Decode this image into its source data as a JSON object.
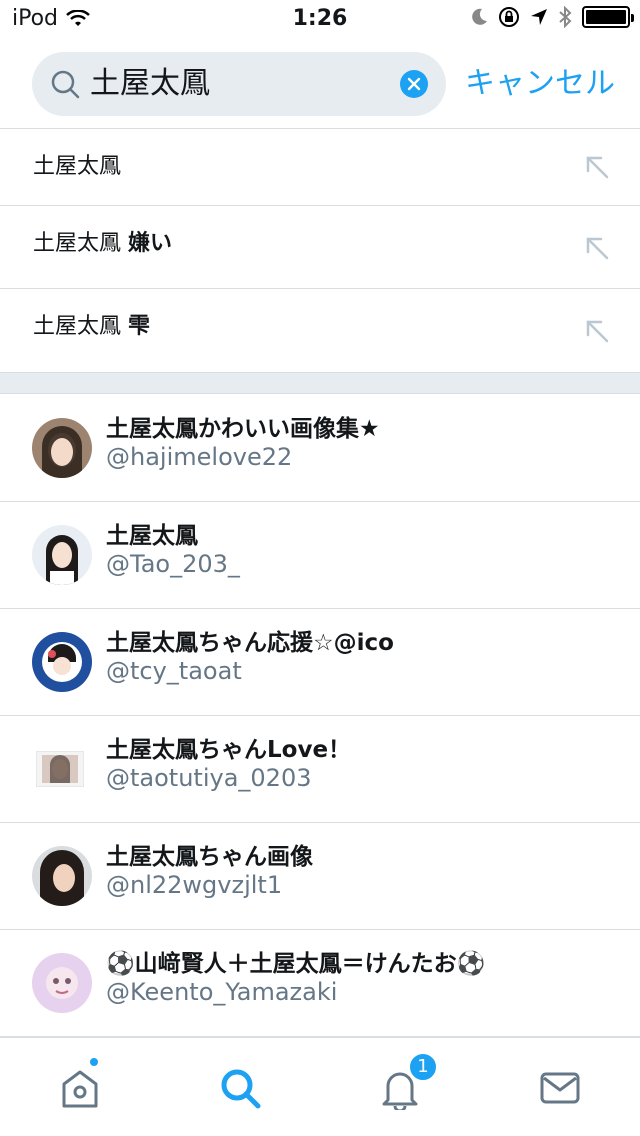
{
  "status_bar": {
    "device": "iPod",
    "time": "1:26"
  },
  "search": {
    "query": "土屋太鳳",
    "cancel_label": "キャンセル"
  },
  "suggestions": [
    {
      "base": "土屋太鳳",
      "extra": ""
    },
    {
      "base": "土屋太鳳",
      "extra": "嫌い"
    },
    {
      "base": "土屋太鳳",
      "extra": "雫"
    }
  ],
  "users": [
    {
      "name": "土屋太鳳かわいい画像集★",
      "handle": "@hajimelove22"
    },
    {
      "name": "土屋太鳳",
      "handle": "@Tao_203_"
    },
    {
      "name": "土屋太鳳ちゃん応援☆@ico",
      "handle": "@tcy_taoat"
    },
    {
      "name": "土屋太鳳ちゃんLove！",
      "handle": "@taotutiya_0203"
    },
    {
      "name": "土屋太鳳ちゃん画像",
      "handle": "@nl22wgvzjlt1"
    },
    {
      "name": "⚽山﨑賢人＋土屋太鳳＝けんたお⚽",
      "handle": "@Keento_Yamazaki"
    }
  ],
  "tabbar": {
    "notifications_badge": "1"
  },
  "colors": {
    "accent": "#1da1f2",
    "secondary_text": "#657786",
    "separator": "#d8dee2"
  }
}
